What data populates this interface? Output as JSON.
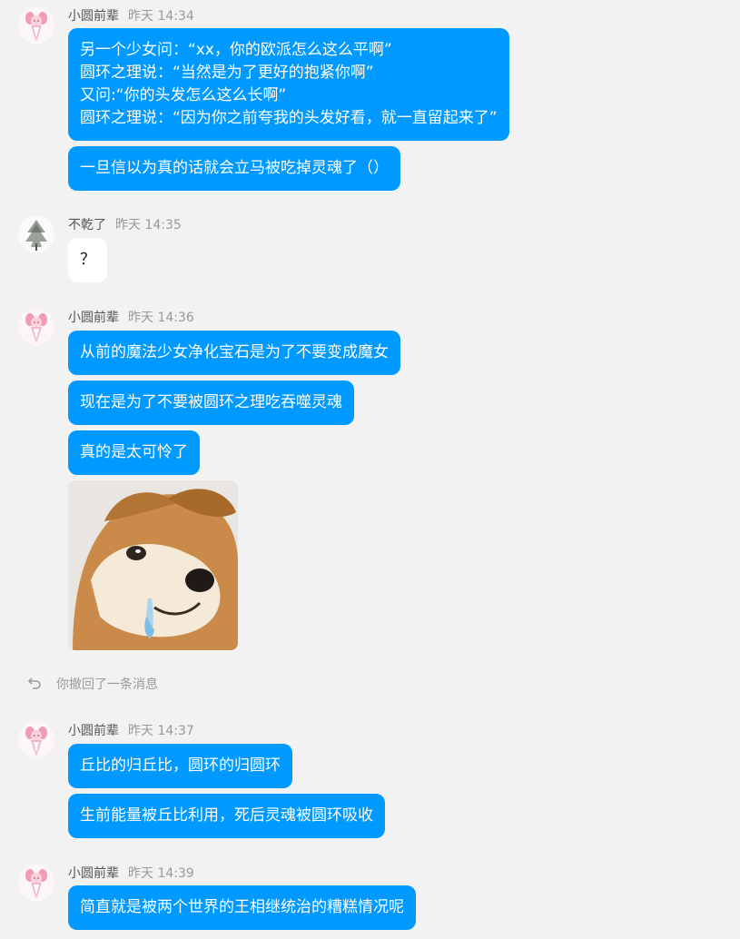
{
  "colors": {
    "page_bg": "#f2f2f2",
    "bubble_blue": "#0099ff",
    "bubble_white": "#ffffff",
    "meta_gray": "#999999"
  },
  "groups": [
    {
      "name": "小圆前辈",
      "time": "昨天 14:34",
      "avatar": "madoka-avatar",
      "messages": [
        "另一个少女问：“xx，你的欧派怎么这么平啊”\n圆环之理说：“当然是为了更好的抱紧你啊”\n又问:“你的头发怎么这么长啊”\n圆环之理说：“因为你之前夸我的头发好看，就一直留起来了”",
        "一旦信以为真的话就会立马被吃掉灵魂了（）"
      ]
    },
    {
      "name": "不乾了",
      "time": "昨天 14:35",
      "avatar": "tree-avatar",
      "messages": [
        "？"
      ]
    },
    {
      "name": "小圆前辈",
      "time": "昨天 14:36",
      "avatar": "madoka-avatar",
      "messages": [
        "从前的魔法少女净化宝石是为了不要变成魔女",
        "现在是为了不要被圆环之理吃吞噬灵魂",
        "真的是太可怜了"
      ],
      "image": "crying-shiba-dog-meme"
    },
    {
      "name": "小圆前辈",
      "time": "昨天 14:37",
      "avatar": "madoka-avatar",
      "messages": [
        "丘比的归丘比，圆环的归圆环",
        "生前能量被丘比利用，死后灵魂被圆环吸收"
      ]
    },
    {
      "name": "小圆前辈",
      "time": "昨天 14:39",
      "avatar": "madoka-avatar",
      "messages": [
        "简直就是被两个世界的王相继统治的糟糕情况呢"
      ]
    }
  ],
  "recall_notice": {
    "icon": "undo-arrow-icon",
    "text": "你撤回了一条消息"
  }
}
